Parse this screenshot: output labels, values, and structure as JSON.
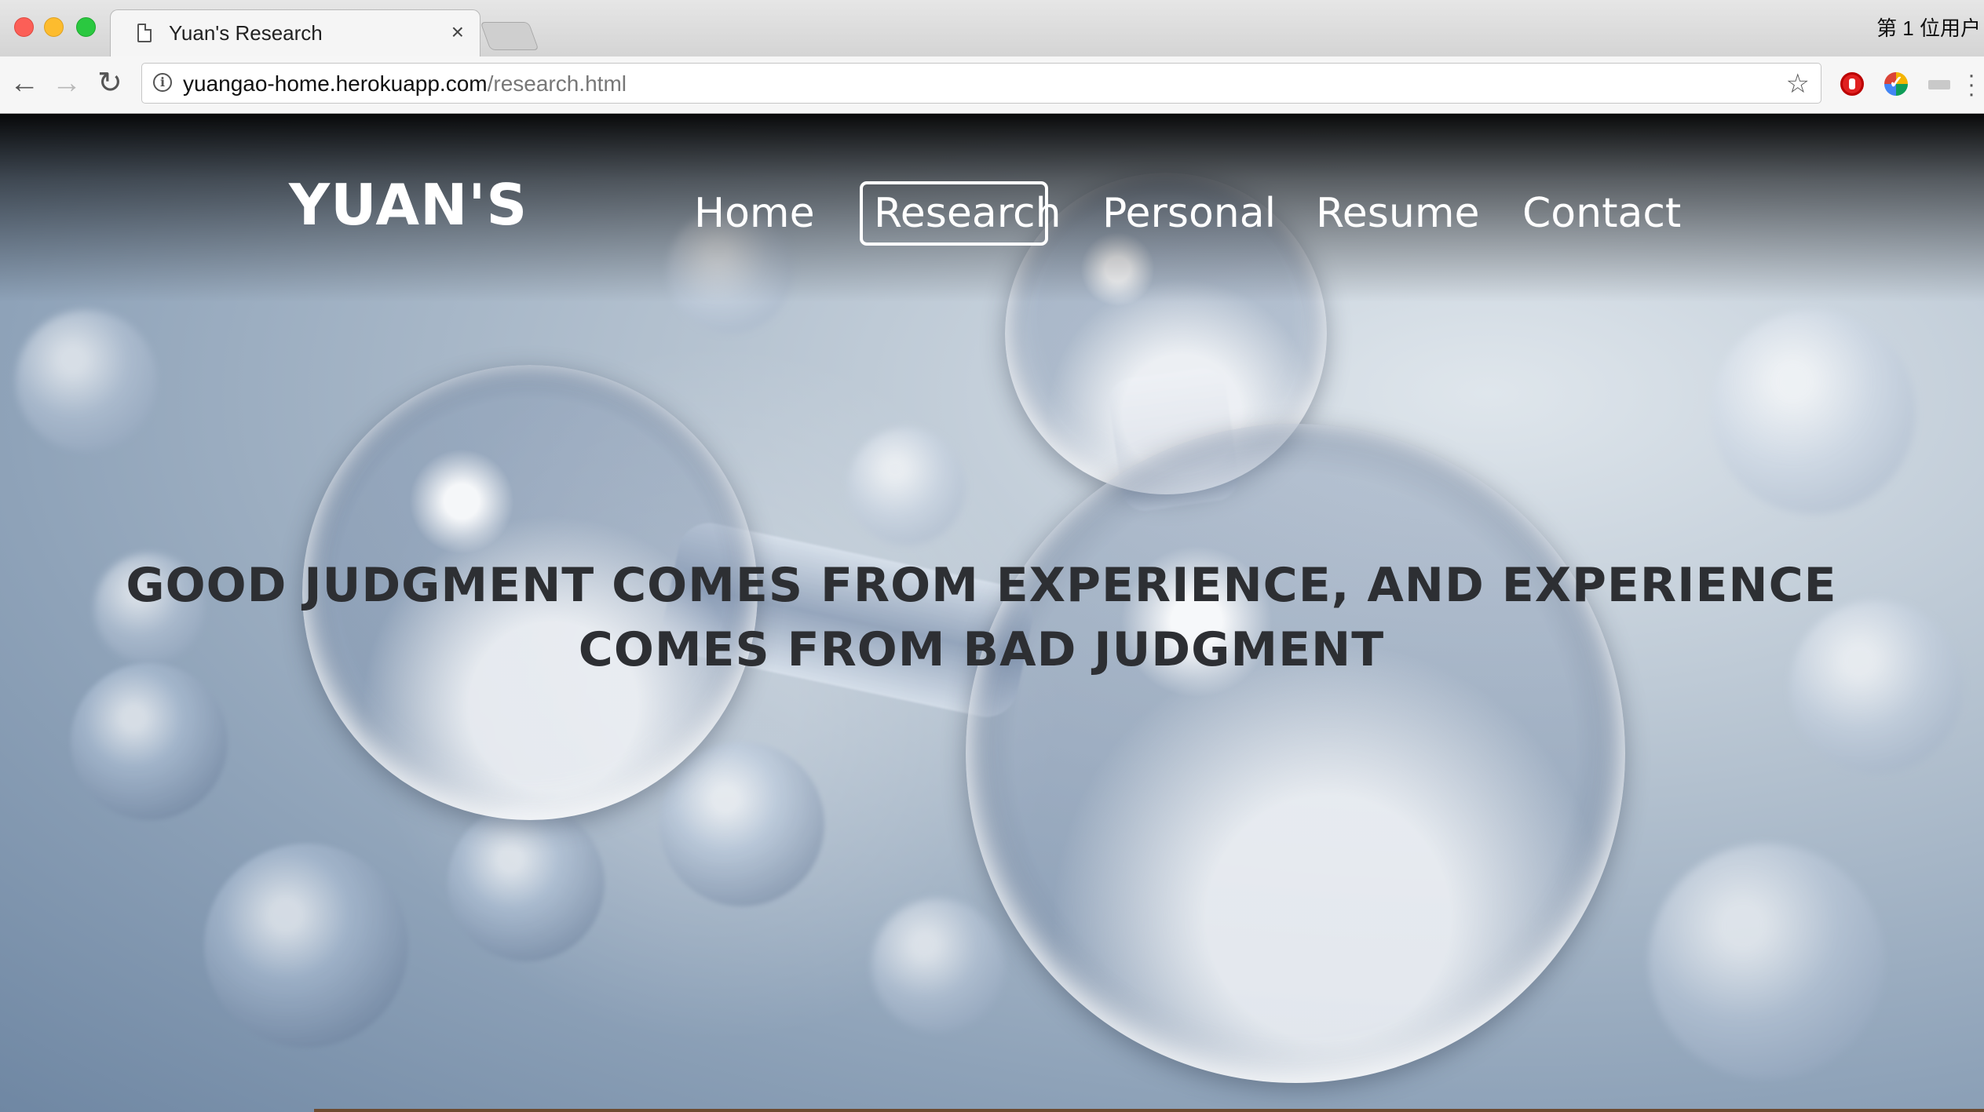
{
  "browser": {
    "tab_title": "Yuan's Research",
    "tab_close": "×",
    "url_host": "yuangao-home.herokuapp.com",
    "url_path": "/research.html",
    "system_text": "第 1 位用户",
    "icons": [
      "back-arrow-icon",
      "forward-arrow-icon",
      "reload-icon",
      "info-icon",
      "star-icon",
      "ublock-icon",
      "chrome-extension-icon",
      "cast-icon",
      "menu-icon"
    ]
  },
  "site": {
    "brand": "YUAN'S",
    "nav": [
      {
        "label": "Home",
        "active": false
      },
      {
        "label": "Research",
        "active": true
      },
      {
        "label": "Personal",
        "active": false
      },
      {
        "label": "Resume",
        "active": false
      },
      {
        "label": "Contact",
        "active": false
      }
    ],
    "headline": "GOOD JUDGMENT COMES FROM EXPERIENCE, AND EXPERIENCE COMES FROM BAD JUDGMENT",
    "colors": {
      "headline": "#2d2f33",
      "nav_text": "#ffffff",
      "active_border": "#ffffff"
    }
  }
}
